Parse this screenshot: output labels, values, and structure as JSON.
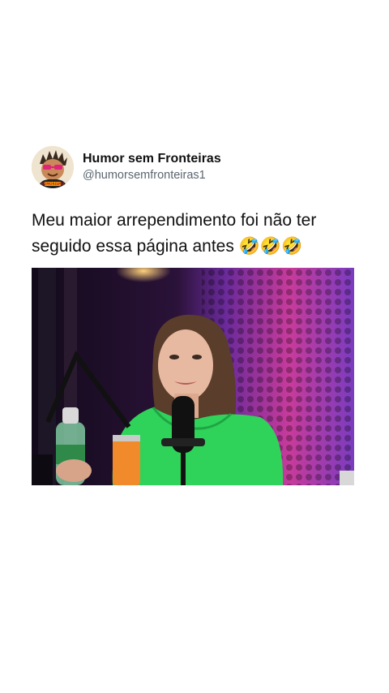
{
  "author": {
    "name": "Humor sem Fronteiras",
    "handle": "@humorsemfronteiras1",
    "avatar_icon": "mascot-avatar-icon",
    "avatar_text": "HUMORISMO"
  },
  "post": {
    "text": "Meu maior arrependimento foi não ter seguido essa página antes 🤣🤣🤣"
  },
  "media": {
    "type": "video-still",
    "description_icon": "video-thumbnail"
  },
  "colors": {
    "name": "#111111",
    "handle": "#5b6670",
    "background": "#ffffff",
    "shirt": "#2fd35a",
    "panel": "#b83aa8"
  }
}
